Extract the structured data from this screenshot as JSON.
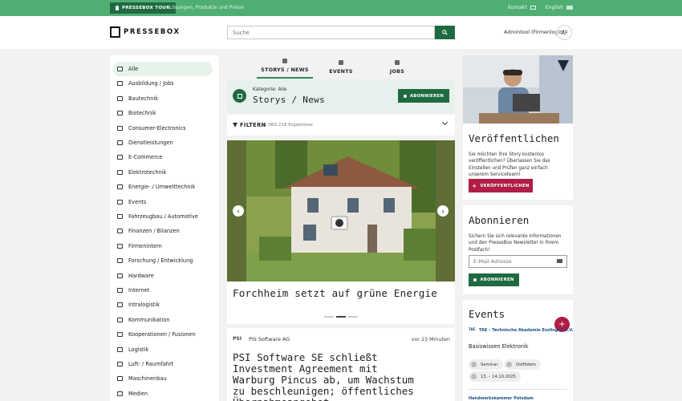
{
  "topbar": {
    "tour_label": "PRESSEBOX TOUR",
    "subtitle": "Lösungen, Produkte und Preise",
    "contact": "Kontakt",
    "language": "English"
  },
  "header": {
    "logo_text": "PRESSEBOX",
    "search_placeholder": "Suche",
    "user_name": "Admintool (Firmenlogin)",
    "avatar_initials": "AF"
  },
  "sidebar": {
    "items": [
      {
        "label": "Alle",
        "icon": "grid-icon"
      },
      {
        "label": "Ausbildung / Jobs",
        "icon": "book-icon"
      },
      {
        "label": "Bautechnik",
        "icon": "excavator-icon"
      },
      {
        "label": "Biotechnik",
        "icon": "syringe-icon"
      },
      {
        "label": "Consumer-Electronics",
        "icon": "devices-icon"
      },
      {
        "label": "Dienstleistungen",
        "icon": "handshake-icon"
      },
      {
        "label": "E-Commerce",
        "icon": "cart-icon"
      },
      {
        "label": "Elektrotechnik",
        "icon": "lightning-icon"
      },
      {
        "label": "Energie- / Umwelttechnik",
        "icon": "solar-icon"
      },
      {
        "label": "Events",
        "icon": "calendar-icon"
      },
      {
        "label": "Fahrzeugbau / Automotive",
        "icon": "car-icon"
      },
      {
        "label": "Finanzen / Bilanzen",
        "icon": "piggy-bank-icon"
      },
      {
        "label": "Firmenintern",
        "icon": "building-icon"
      },
      {
        "label": "Forschung / Entwicklung",
        "icon": "lab-icon"
      },
      {
        "label": "Hardware",
        "icon": "chip-icon"
      },
      {
        "label": "Internet",
        "icon": "laptop-icon"
      },
      {
        "label": "Intralogistik",
        "icon": "forklift-icon"
      },
      {
        "label": "Kommunikation",
        "icon": "satellite-icon"
      },
      {
        "label": "Kooperationen / Fusionen",
        "icon": "merge-icon"
      },
      {
        "label": "Logistik",
        "icon": "truck-icon"
      },
      {
        "label": "Luft- / Raumfahrt",
        "icon": "plane-icon"
      },
      {
        "label": "Maschinenbau",
        "icon": "gears-icon"
      },
      {
        "label": "Medien",
        "icon": "media-icon"
      }
    ]
  },
  "tabs": [
    {
      "label": "STORYS / NEWS",
      "active": true
    },
    {
      "label": "EVENTS",
      "active": false
    },
    {
      "label": "JOBS",
      "active": false
    }
  ],
  "category": {
    "small": "Kategorie: Alle",
    "title": "Storys / News",
    "subscribe_label": "ABONNIEREN"
  },
  "filter": {
    "label": "FILTERN",
    "count": "1.060.219 Ergebnisse"
  },
  "story": {
    "title": "Forchheim setzt auf grüne Energie",
    "prev": "‹",
    "next": "›"
  },
  "news": {
    "logo": "PSI",
    "company": "PSI Software AG",
    "time": "vor 23 Minuten",
    "title": "PSI Software SE schließt Investment Agreement mit Warburg Pincus ab, um Wachstum zu beschleunigen; öf­fentliches Übernahmeangebot..."
  },
  "publish": {
    "title": "Veröffentlichen",
    "text": "Sie möchten Ihre Story kostenlos veröffentli­chen? Überlassen Sie das Einstellen und Prü­fen ganz einfach unserem Serviceteam!",
    "button": "VERÖFFENTLICHEN"
  },
  "subscribe": {
    "title": "Abonnieren",
    "text": "Sichern Sie sich relevante Informationen und den PresseBox Newsletter in Ihrem Postfach!",
    "email_placeholder": "E-Mail-Adresse",
    "button": "ABONNIEREN"
  },
  "events": {
    "title": "Events",
    "add": "+",
    "org": "TAE – Technische Akademie Esslingen e.V.",
    "name": "Basiswissen Elektronik",
    "type": "Seminar",
    "region": "Ostfildern",
    "dates": "13. – 14.10.2025",
    "next_org": "Handwerkskammer Potsdam"
  },
  "colors": {
    "brand_green": "#1f6a41",
    "topbar_green": "#4fae74",
    "accent_red": "#b01d45"
  }
}
